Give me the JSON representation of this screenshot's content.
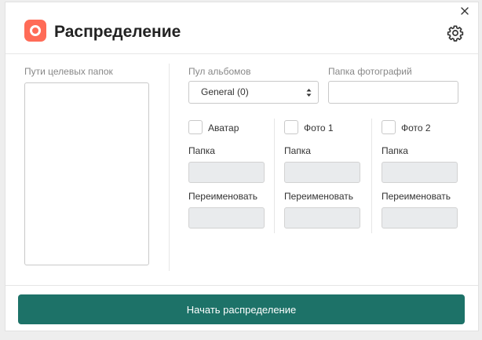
{
  "window": {
    "title": "Распределение",
    "brand_color": "#ff6b57",
    "accent_color": "#1d7268"
  },
  "left": {
    "paths_label": "Пути целевых папок"
  },
  "top": {
    "album_pool_label": "Пул альбомов",
    "album_pool_value": "General (0)",
    "photo_folder_label": "Папка фотографий",
    "photo_folder_value": ""
  },
  "columns": [
    {
      "checkbox_label": "Аватар",
      "checked": false,
      "folder_label": "Папка",
      "rename_label": "Переименовать"
    },
    {
      "checkbox_label": "Фото 1",
      "checked": false,
      "folder_label": "Папка",
      "rename_label": "Переименовать"
    },
    {
      "checkbox_label": "Фото 2",
      "checked": false,
      "folder_label": "Папка",
      "rename_label": "Переименовать"
    }
  ],
  "footer": {
    "start_label": "Начать распределение"
  },
  "icons": {
    "close": "close-icon",
    "settings": "gear-icon",
    "logo": "app-logo-icon",
    "select": "chevron-up-down-icon"
  }
}
